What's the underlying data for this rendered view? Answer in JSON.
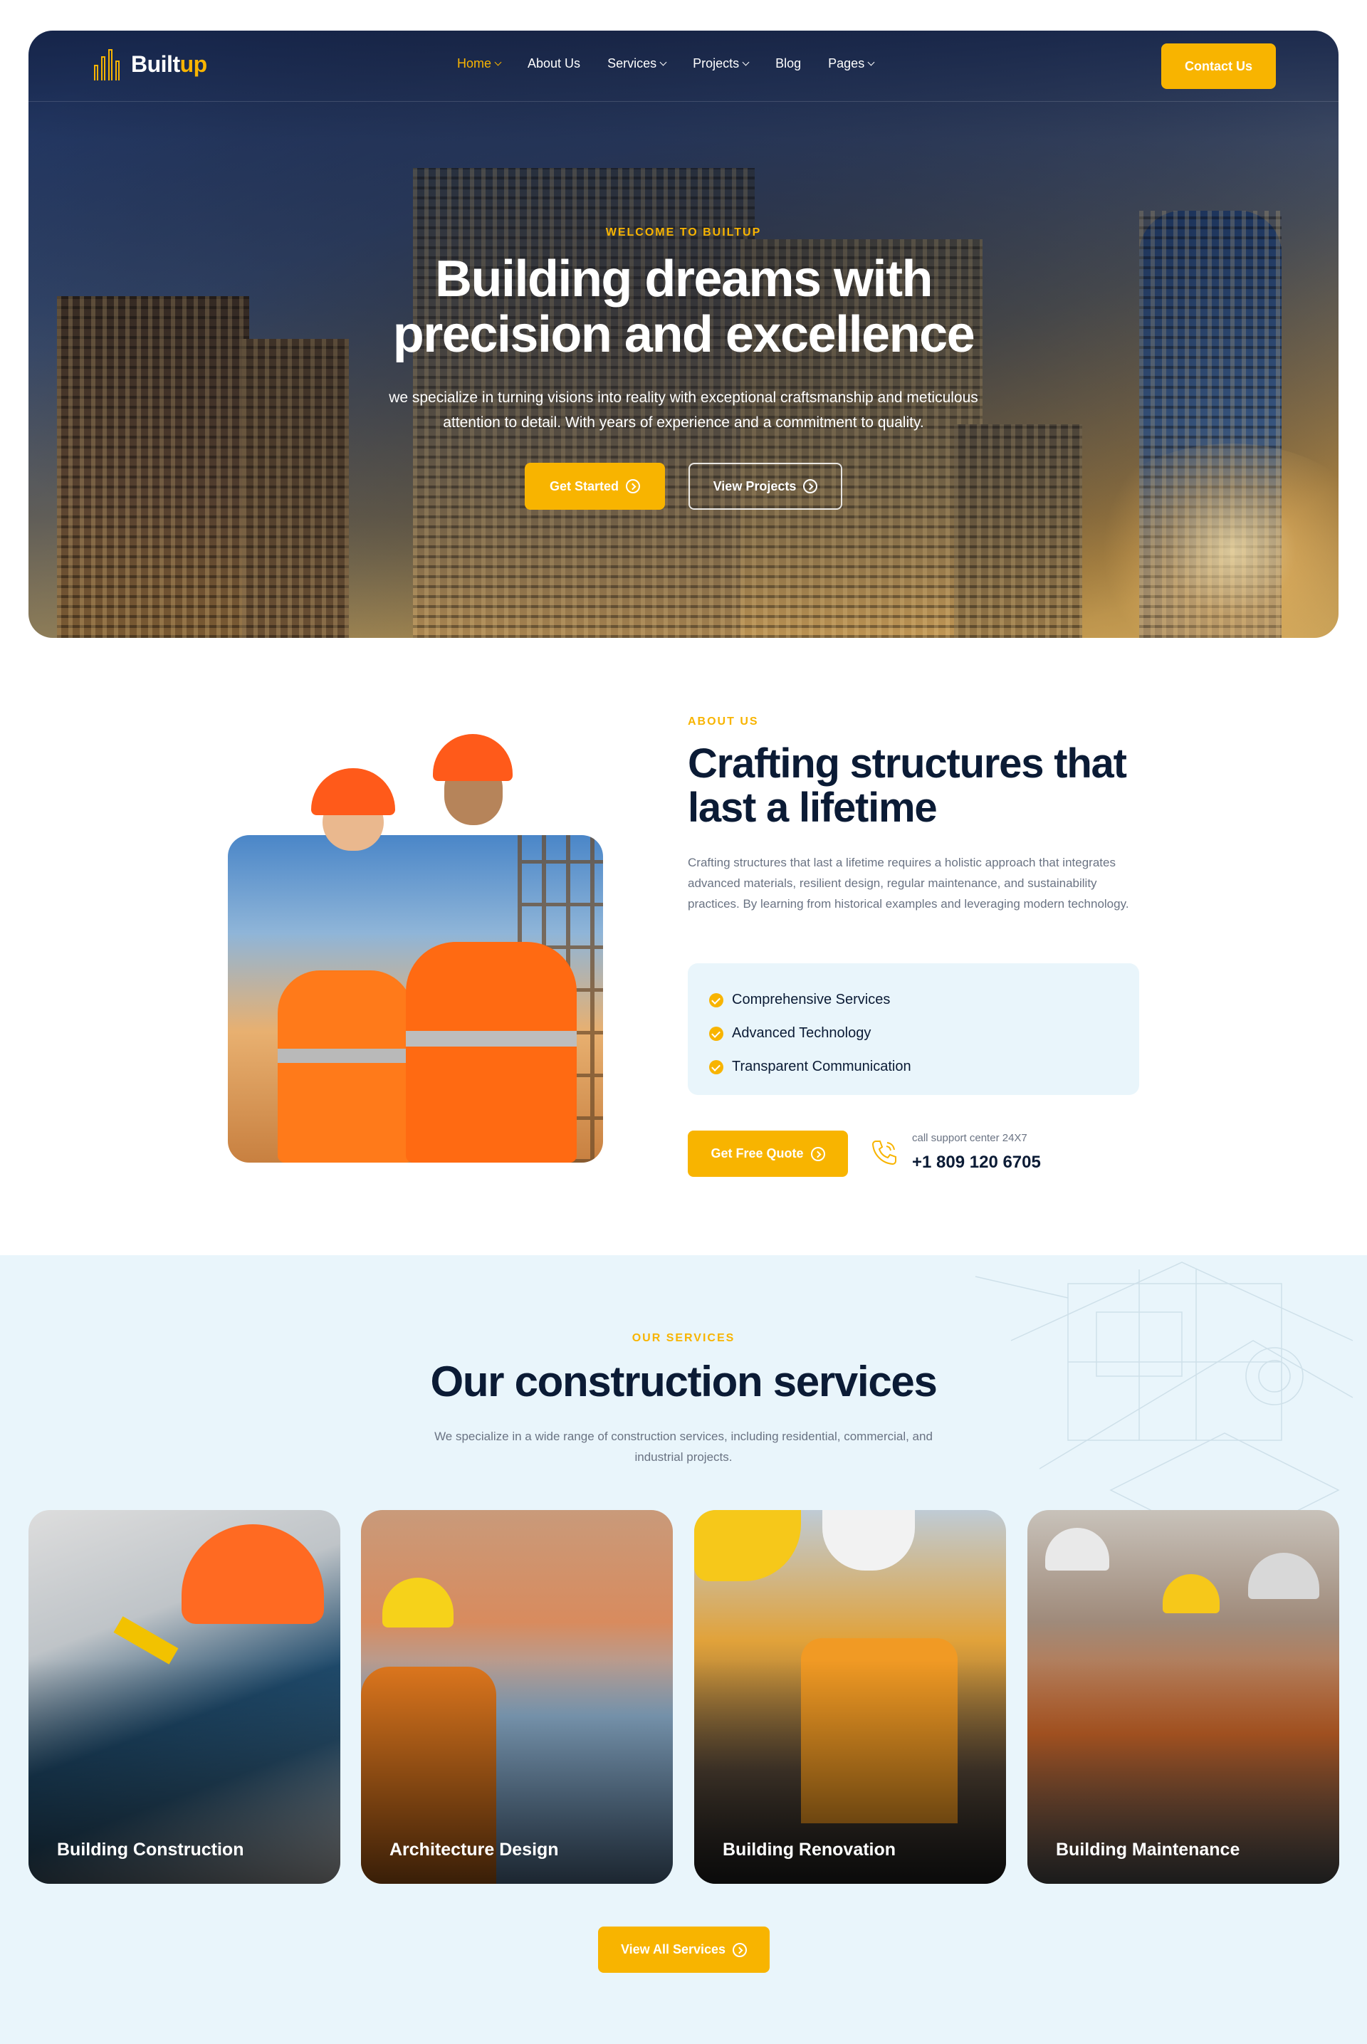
{
  "brand": {
    "name_main": "Built",
    "name_accent": "up",
    "accent_color": "#f8b400"
  },
  "nav": {
    "items": [
      {
        "label": "Home",
        "dropdown": true,
        "active": true
      },
      {
        "label": "About Us",
        "dropdown": false
      },
      {
        "label": "Services",
        "dropdown": true
      },
      {
        "label": "Projects",
        "dropdown": true
      },
      {
        "label": "Blog",
        "dropdown": false
      },
      {
        "label": "Pages",
        "dropdown": true
      }
    ],
    "contact_label": "Contact Us"
  },
  "hero": {
    "eyebrow": "WELCOME TO BUILTUP",
    "title_line1": "Building dreams with",
    "title_line2": "precision and excellence",
    "desc_line1": "we specialize in turning visions into reality with exceptional craftsmanship and meticulous",
    "desc_line2": "attention to detail. With years of experience and a commitment to quality.",
    "primary_label": "Get Started",
    "secondary_label": "View Projects"
  },
  "about": {
    "eyebrow": "ABOUT US",
    "title_line1": "Crafting structures that",
    "title_line2": "last a lifetime",
    "desc": "Crafting structures that last a lifetime requires a holistic approach that integrates advanced materials, resilient design, regular maintenance, and sustainability practices. By learning from historical examples and leveraging modern technology.",
    "features": [
      "Comprehensive Services",
      "Advanced Technology",
      "Transparent Communication"
    ],
    "quote_label": "Get Free Quote",
    "support_label": "call support center 24X7",
    "support_phone": "+1 809 120 6705"
  },
  "services": {
    "eyebrow": "OUR SERVICES",
    "title": "Our construction services",
    "desc_line1": "We specialize in a wide range of construction services, including residential, commercial, and",
    "desc_line2": "industrial projects.",
    "cards": [
      {
        "title": "Building Construction"
      },
      {
        "title": "Architecture Design"
      },
      {
        "title": "Building Renovation"
      },
      {
        "title": "Building Maintenance"
      }
    ],
    "all_label": "View All Services"
  }
}
